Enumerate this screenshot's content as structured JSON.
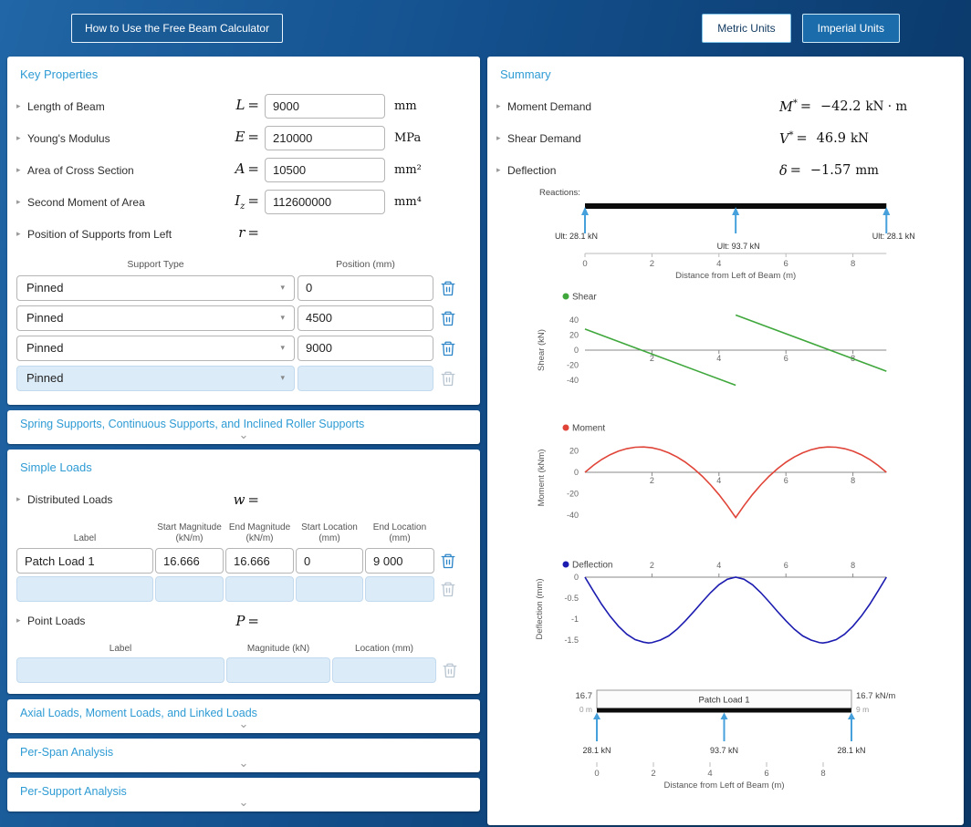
{
  "strings": {
    "eq": "="
  },
  "icons": {
    "caret_right": "▸",
    "select_caret": "▾",
    "collapse_chevron": "⌄"
  },
  "topbar": {
    "help_button": "How to Use the Free Beam Calculator",
    "metric_button": "Metric Units",
    "imperial_button": "Imperial Units"
  },
  "key_properties": {
    "title": "Key Properties",
    "properties": [
      {
        "label": "Length of Beam",
        "sym": "L",
        "sub": "",
        "value": "9000",
        "unit": "mm"
      },
      {
        "label": "Young's Modulus",
        "sym": "E",
        "sub": "",
        "value": "210000",
        "unit": "MPa"
      },
      {
        "label": "Area of Cross Section",
        "sym": "A",
        "sub": "",
        "value": "10500",
        "unit": "mm²"
      },
      {
        "label": "Second Moment of Area",
        "sym": "I",
        "sub": "z",
        "value": "112600000",
        "unit": "mm⁴"
      },
      {
        "label": "Position of Supports from Left",
        "sym": "r",
        "sub": ""
      }
    ],
    "supports": {
      "headers": [
        "Support Type",
        "Position (mm)"
      ],
      "rows": [
        {
          "type": "Pinned",
          "position": "0"
        },
        {
          "type": "Pinned",
          "position": "4500"
        },
        {
          "type": "Pinned",
          "position": "9000"
        },
        {
          "type": "Pinned",
          "position": ""
        }
      ]
    }
  },
  "spring_section": {
    "title": "Spring Supports, Continuous Supports, and Inclined Roller Supports"
  },
  "simple_loads": {
    "title": "Simple Loads",
    "distributed": {
      "label": "Distributed Loads",
      "sym": "w",
      "headers": [
        {
          "l1": "Label",
          "l2": ""
        },
        {
          "l1": "Start Magnitude",
          "l2": "(kN/m)"
        },
        {
          "l1": "End Magnitude",
          "l2": "(kN/m)"
        },
        {
          "l1": "Start Location",
          "l2": "(mm)"
        },
        {
          "l1": "End Location",
          "l2": "(mm)"
        }
      ],
      "rows": [
        {
          "label": "Patch Load 1",
          "start_mag": "16.666",
          "end_mag": "16.666",
          "start_loc": "0",
          "end_loc": "9 000"
        },
        {
          "label": "",
          "start_mag": "",
          "end_mag": "",
          "start_loc": "",
          "end_loc": ""
        }
      ]
    },
    "point": {
      "label": "Point Loads",
      "sym": "P",
      "headers": [
        {
          "l1": "Label"
        },
        {
          "l1": "Magnitude (kN)"
        },
        {
          "l1": "Location (mm)"
        }
      ],
      "rows": [
        {
          "label": "",
          "magnitude": "",
          "location": ""
        }
      ]
    }
  },
  "collapsed_sections": [
    {
      "title": "Axial Loads, Moment Loads, and Linked Loads"
    },
    {
      "title": "Per-Span Analysis"
    },
    {
      "title": "Per-Support Analysis"
    }
  ],
  "summary": {
    "title": "Summary",
    "rows": [
      {
        "label": "Moment Demand",
        "sym": "M",
        "sup": "*",
        "value": "−42.2",
        "unit": "kN · m"
      },
      {
        "label": "Shear Demand",
        "sym": "V",
        "sup": "*",
        "value": "46.9",
        "unit": "kN"
      },
      {
        "label": "Deflection",
        "sym": "δ",
        "sup": "",
        "value": "−1.57",
        "unit": "mm"
      }
    ]
  },
  "chart_data": [
    {
      "id": "reactions",
      "type": "diagram",
      "title": "Reactions:",
      "beam_span_m": [
        0,
        9
      ],
      "supports": [
        {
          "x": 0,
          "label": "Ult: 28.1 kN"
        },
        {
          "x": 4.5,
          "label": "Ult: 93.7 kN"
        },
        {
          "x": 9,
          "label": "Ult: 28.1 kN"
        }
      ],
      "x_ticks": [
        0,
        2,
        4,
        6,
        8
      ],
      "xlabel": "Distance from Left of Beam (m)"
    },
    {
      "id": "shear",
      "type": "line",
      "legend": "Shear",
      "color": "#3fa73c",
      "ylabel": "Shear (kN)",
      "y_ticks": [
        40,
        20,
        0,
        -20,
        -40
      ],
      "ylim": [
        -52,
        55
      ],
      "x_ticks": [
        2,
        4,
        6,
        8
      ],
      "xlim": [
        0,
        9
      ],
      "series": [
        {
          "points": [
            [
              0,
              28.1
            ],
            [
              4.5,
              -46.9
            ]
          ]
        },
        {
          "points": [
            [
              4.5,
              46.9
            ],
            [
              9,
              -28.1
            ]
          ]
        }
      ]
    },
    {
      "id": "moment",
      "type": "line",
      "legend": "Moment",
      "color": "#e04438",
      "ylabel": "Moment (kNm)",
      "y_ticks": [
        20,
        0,
        -20,
        -40
      ],
      "ylim": [
        -46,
        30
      ],
      "x_ticks": [
        2,
        4,
        6,
        8
      ],
      "xlim": [
        0,
        9
      ],
      "series": [
        {
          "points": [
            [
              0,
              0
            ],
            [
              0.25,
              6.5
            ],
            [
              0.5,
              12.0
            ],
            [
              0.75,
              16.4
            ],
            [
              1,
              19.8
            ],
            [
              1.25,
              22.1
            ],
            [
              1.5,
              23.4
            ],
            [
              1.75,
              23.7
            ],
            [
              2,
              22.9
            ],
            [
              2.25,
              21.1
            ],
            [
              2.5,
              18.2
            ],
            [
              2.75,
              14.3
            ],
            [
              3,
              9.4
            ],
            [
              3.25,
              3.4
            ],
            [
              3.5,
              -3.6
            ],
            [
              3.75,
              -11.7
            ],
            [
              4,
              -20.8
            ],
            [
              4.25,
              -31.0
            ],
            [
              4.5,
              -42.2
            ],
            [
              4.75,
              -31.0
            ],
            [
              5,
              -20.8
            ],
            [
              5.25,
              -11.7
            ],
            [
              5.5,
              -3.6
            ],
            [
              5.75,
              3.4
            ],
            [
              6,
              9.4
            ],
            [
              6.25,
              14.3
            ],
            [
              6.5,
              18.2
            ],
            [
              6.75,
              21.1
            ],
            [
              7,
              22.9
            ],
            [
              7.25,
              23.7
            ],
            [
              7.5,
              23.4
            ],
            [
              7.75,
              22.1
            ],
            [
              8,
              19.8
            ],
            [
              8.25,
              16.4
            ],
            [
              8.5,
              12.0
            ],
            [
              8.75,
              6.5
            ],
            [
              9,
              0
            ]
          ]
        }
      ]
    },
    {
      "id": "deflection",
      "type": "line",
      "legend": "Deflection",
      "color": "#1c1cb0",
      "ylabel": "Deflection (mm)",
      "y_ticks": [
        0,
        -0.5,
        -1,
        -1.5
      ],
      "ylim": [
        -1.75,
        0.1
      ],
      "x_ticks": [
        2,
        4,
        6,
        8
      ],
      "x_ticks_top": true,
      "xlim": [
        0,
        9
      ],
      "series": [
        {
          "points": [
            [
              0,
              0
            ],
            [
              0.25,
              -0.33
            ],
            [
              0.5,
              -0.65
            ],
            [
              0.75,
              -0.93
            ],
            [
              1,
              -1.17
            ],
            [
              1.25,
              -1.36
            ],
            [
              1.5,
              -1.49
            ],
            [
              1.75,
              -1.55
            ],
            [
              1.9,
              -1.57
            ],
            [
              2,
              -1.56
            ],
            [
              2.25,
              -1.5
            ],
            [
              2.5,
              -1.4
            ],
            [
              2.75,
              -1.24
            ],
            [
              3,
              -1.04
            ],
            [
              3.25,
              -0.82
            ],
            [
              3.5,
              -0.59
            ],
            [
              3.75,
              -0.37
            ],
            [
              4,
              -0.18
            ],
            [
              4.25,
              -0.05
            ],
            [
              4.5,
              0
            ],
            [
              4.75,
              -0.05
            ],
            [
              5,
              -0.18
            ],
            [
              5.25,
              -0.37
            ],
            [
              5.5,
              -0.59
            ],
            [
              5.75,
              -0.82
            ],
            [
              6,
              -1.04
            ],
            [
              6.25,
              -1.24
            ],
            [
              6.5,
              -1.4
            ],
            [
              6.75,
              -1.5
            ],
            [
              7,
              -1.56
            ],
            [
              7.1,
              -1.57
            ],
            [
              7.25,
              -1.55
            ],
            [
              7.5,
              -1.49
            ],
            [
              7.75,
              -1.36
            ],
            [
              8,
              -1.17
            ],
            [
              8.25,
              -0.93
            ],
            [
              8.5,
              -0.65
            ],
            [
              8.75,
              -0.33
            ],
            [
              9,
              0
            ]
          ]
        }
      ]
    },
    {
      "id": "loads",
      "type": "diagram",
      "load_label": "Patch Load 1",
      "left_value": "16.7",
      "right_value": "16.7 kN/m",
      "start_label": "0 m",
      "end_label": "9 m",
      "supports": [
        {
          "x": 0,
          "label": "28.1 kN"
        },
        {
          "x": 4.5,
          "label": "93.7 kN"
        },
        {
          "x": 9,
          "label": "28.1 kN"
        }
      ],
      "x_ticks": [
        0,
        2,
        4,
        6,
        8
      ],
      "xlabel": "Distance from Left of Beam (m)"
    }
  ]
}
